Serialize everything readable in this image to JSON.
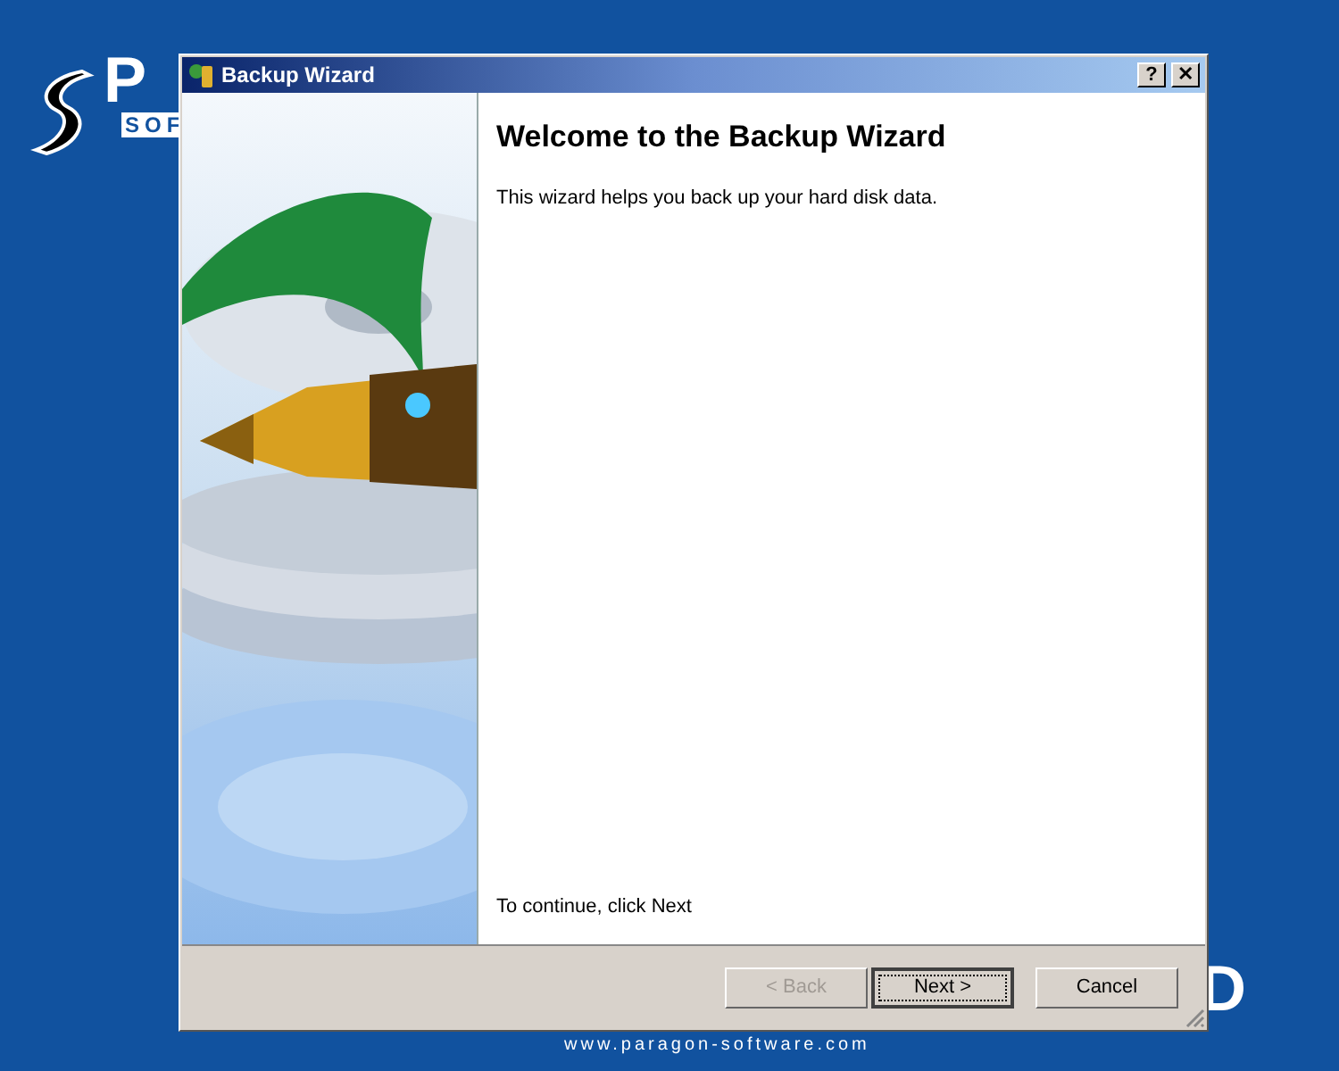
{
  "desktop": {
    "logo_letter": "P",
    "logo_band": "SOF",
    "logo_tail": "D",
    "url": "www.paragon-software.com"
  },
  "window": {
    "title": "Backup Wizard",
    "title_buttons": [
      {
        "label": "?"
      },
      {
        "label": "✕"
      }
    ]
  },
  "content": {
    "heading": "Welcome to the Backup Wizard",
    "intro": "This wizard helps you back up your hard disk data.",
    "footer": "To continue, click Next"
  },
  "buttons": [
    {
      "label": "< Back",
      "disabled": true,
      "default": false
    },
    {
      "label": "Next >",
      "disabled": false,
      "default": true
    },
    {
      "label": "Cancel",
      "disabled": false,
      "default": false
    }
  ]
}
